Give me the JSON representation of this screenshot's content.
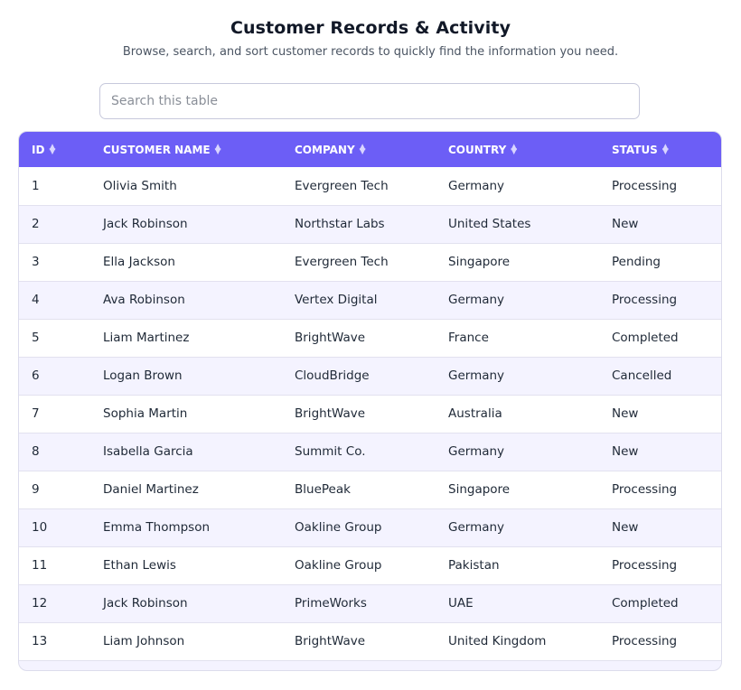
{
  "header": {
    "title": "Customer Records & Activity",
    "subtitle": "Browse, search, and sort customer records to quickly find the information you need."
  },
  "search": {
    "placeholder": "Search this table",
    "value": ""
  },
  "table": {
    "columns": [
      {
        "key": "id",
        "label": "ID",
        "icon": "sort-icon"
      },
      {
        "key": "name",
        "label": "CUSTOMER NAME",
        "icon": "sort-icon"
      },
      {
        "key": "company",
        "label": "COMPANY",
        "icon": "sort-icon"
      },
      {
        "key": "country",
        "label": "COUNTRY",
        "icon": "sort-icon"
      },
      {
        "key": "status",
        "label": "STATUS",
        "icon": "sort-icon"
      }
    ],
    "rows": [
      {
        "id": "1",
        "name": "Olivia Smith",
        "company": "Evergreen Tech",
        "country": "Germany",
        "status": "Processing"
      },
      {
        "id": "2",
        "name": "Jack Robinson",
        "company": "Northstar Labs",
        "country": "United States",
        "status": "New"
      },
      {
        "id": "3",
        "name": "Ella Jackson",
        "company": "Evergreen Tech",
        "country": "Singapore",
        "status": "Pending"
      },
      {
        "id": "4",
        "name": "Ava Robinson",
        "company": "Vertex Digital",
        "country": "Germany",
        "status": "Processing"
      },
      {
        "id": "5",
        "name": "Liam Martinez",
        "company": "BrightWave",
        "country": "France",
        "status": "Completed"
      },
      {
        "id": "6",
        "name": "Logan Brown",
        "company": "CloudBridge",
        "country": "Germany",
        "status": "Cancelled"
      },
      {
        "id": "7",
        "name": "Sophia Martin",
        "company": "BrightWave",
        "country": "Australia",
        "status": "New"
      },
      {
        "id": "8",
        "name": "Isabella Garcia",
        "company": "Summit Co.",
        "country": "Germany",
        "status": "New"
      },
      {
        "id": "9",
        "name": "Daniel Martinez",
        "company": "BluePeak",
        "country": "Singapore",
        "status": "Processing"
      },
      {
        "id": "10",
        "name": "Emma Thompson",
        "company": "Oakline Group",
        "country": "Germany",
        "status": "New"
      },
      {
        "id": "11",
        "name": "Ethan Lewis",
        "company": "Oakline Group",
        "country": "Pakistan",
        "status": "Processing"
      },
      {
        "id": "12",
        "name": "Jack Robinson",
        "company": "PrimeWorks",
        "country": "UAE",
        "status": "Completed"
      },
      {
        "id": "13",
        "name": "Liam Johnson",
        "company": "BrightWave",
        "country": "United Kingdom",
        "status": "Processing"
      }
    ]
  },
  "colors": {
    "header_bg": "#6c5ef6",
    "row_alt_bg": "#f4f3ff",
    "row_bg": "#ffffff"
  }
}
